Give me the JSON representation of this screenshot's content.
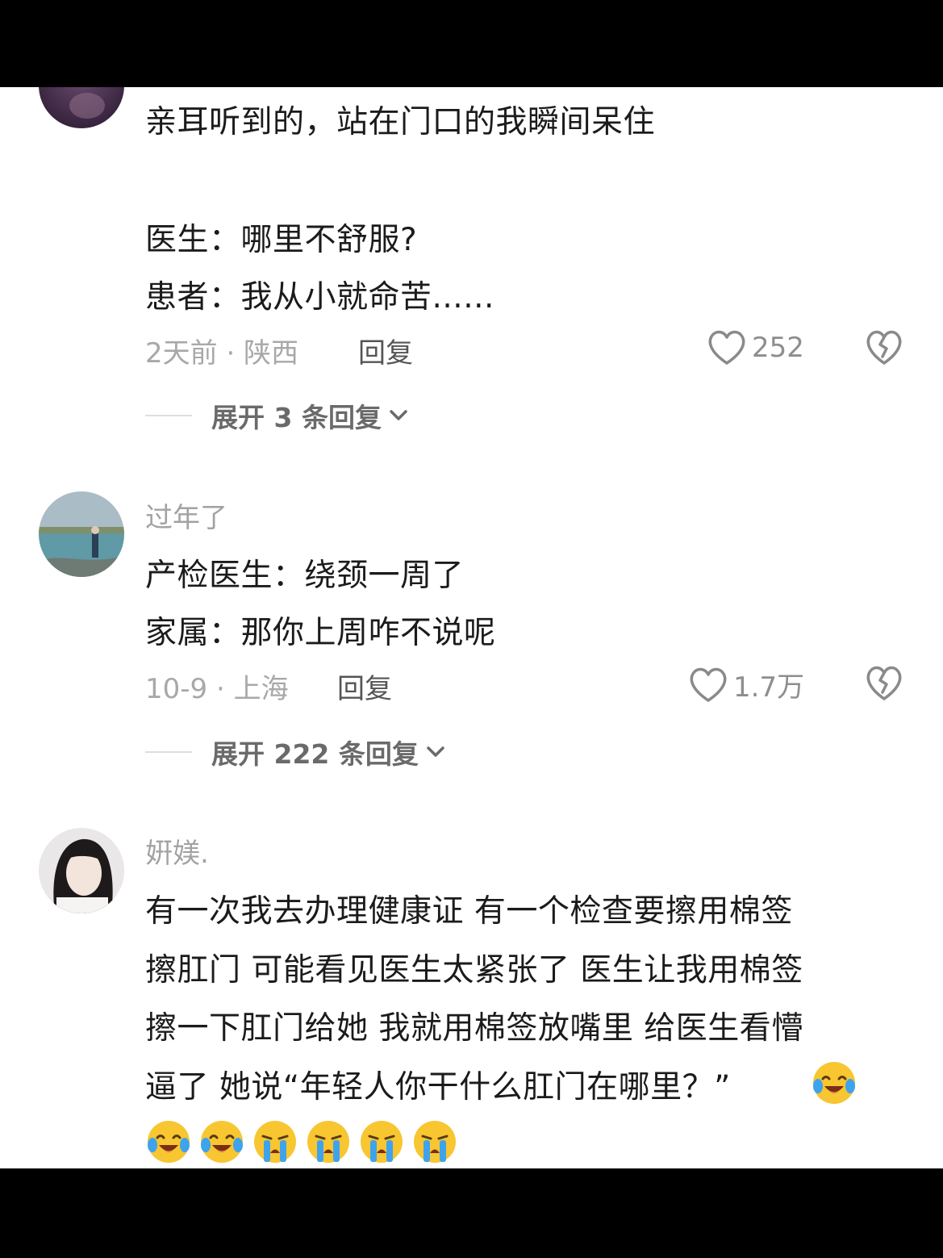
{
  "comments": [
    {
      "username": "",
      "lines": [
        "亲耳听到的，站在门口的我瞬间呆住",
        "医生：哪里不舒服?",
        "患者：我从小就命苦......"
      ],
      "meta": "2天前 · 陕西",
      "reply_label": "回复",
      "likes": "252",
      "expand_label": "展开 3 条回复"
    },
    {
      "username": "过年了",
      "lines": [
        "产检医生：绕颈一周了",
        "家属：那你上周咋不说呢"
      ],
      "meta": "10-9 · 上海",
      "reply_label": "回复",
      "likes": "1.7万",
      "expand_label": "展开 222 条回复"
    },
    {
      "username": "姸媄.",
      "lines": [
        "有一次我去办理健康证 有一个检查要擦用棉签",
        "擦肛门  可能看见医生太紧张了 医生让我用棉签",
        "擦一下肛门给她 我就用棉签放嘴里 给医生看懵",
        "逼了 她说“年轻人你干什么肛门在哪里？”"
      ],
      "emojis": [
        "laugh-cry",
        "laugh-cry",
        "laugh-cry",
        "crying",
        "crying",
        "crying",
        "crying"
      ]
    }
  ],
  "colors": {
    "text": "#1b1b1b",
    "meta": "#a8a8a8",
    "username": "#a2a2a2",
    "emoji_yellow": "#f7c631",
    "tear_blue": "#3ea3ec"
  }
}
